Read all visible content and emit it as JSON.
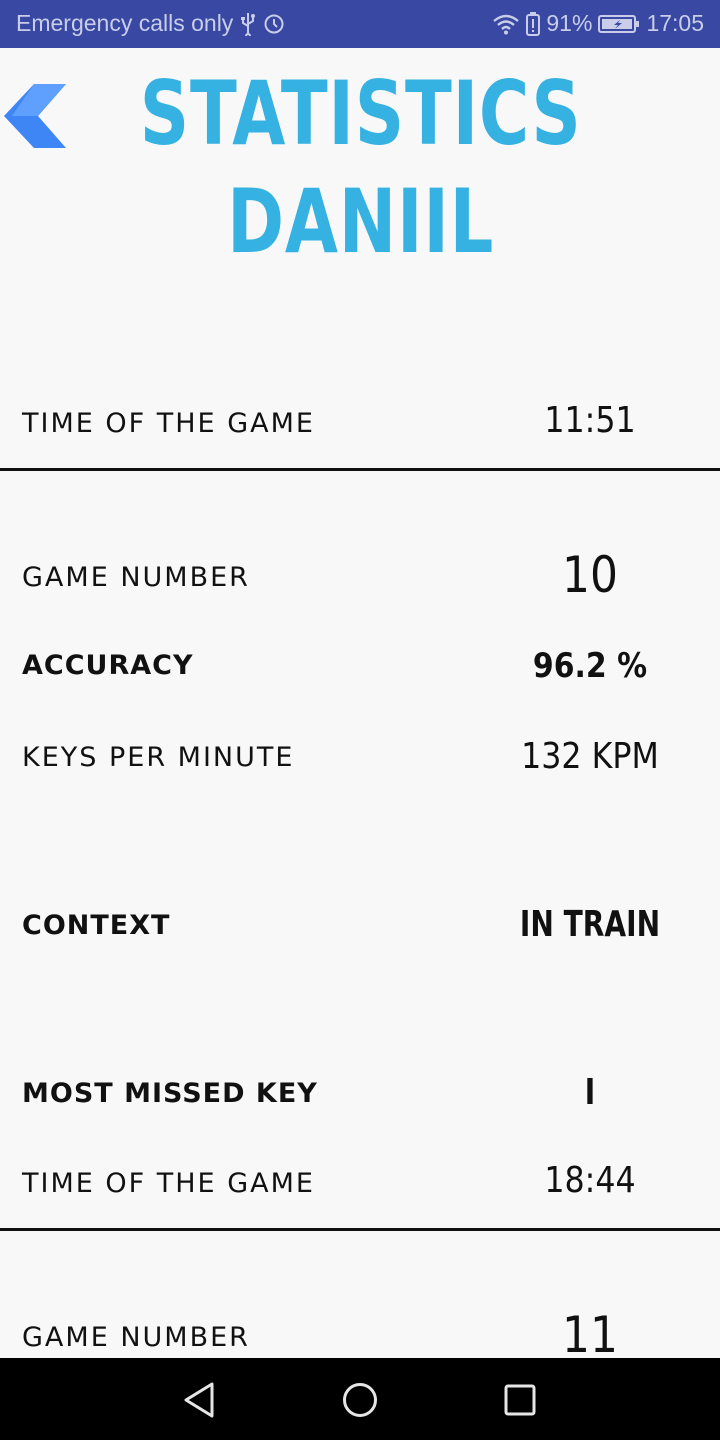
{
  "status_bar": {
    "carrier_text": "Emergency calls only",
    "battery_percent": "91%",
    "time": "17:05",
    "icons": [
      "usb-icon",
      "alarm-icon",
      "wifi-icon",
      "battery-alert-icon",
      "battery-icon"
    ]
  },
  "header": {
    "title_line1": "STATISTICS",
    "title_line2": "DANIIL",
    "back_icon": "chevron-left-icon",
    "title_color": "#35b2e1",
    "back_color": "#3e86f5"
  },
  "stats": [
    {
      "label": "TIME OF THE GAME",
      "value": "11:51"
    },
    {
      "label": "GAME NUMBER",
      "value": "10"
    },
    {
      "label": "ACCURACY",
      "value": "96.2 %"
    },
    {
      "label": "KEYS PER MINUTE",
      "value": "132 KPM"
    },
    {
      "label": "CONTEXT",
      "value": "IN TRAIN"
    },
    {
      "label": "MOST MISSED KEY",
      "value": "I"
    },
    {
      "label": "TIME OF THE GAME",
      "value": "18:44"
    },
    {
      "label": "GAME NUMBER",
      "value": "11"
    }
  ],
  "nav_bar": {
    "buttons": [
      "back-triangle-icon",
      "home-circle-icon",
      "recents-square-icon"
    ]
  }
}
